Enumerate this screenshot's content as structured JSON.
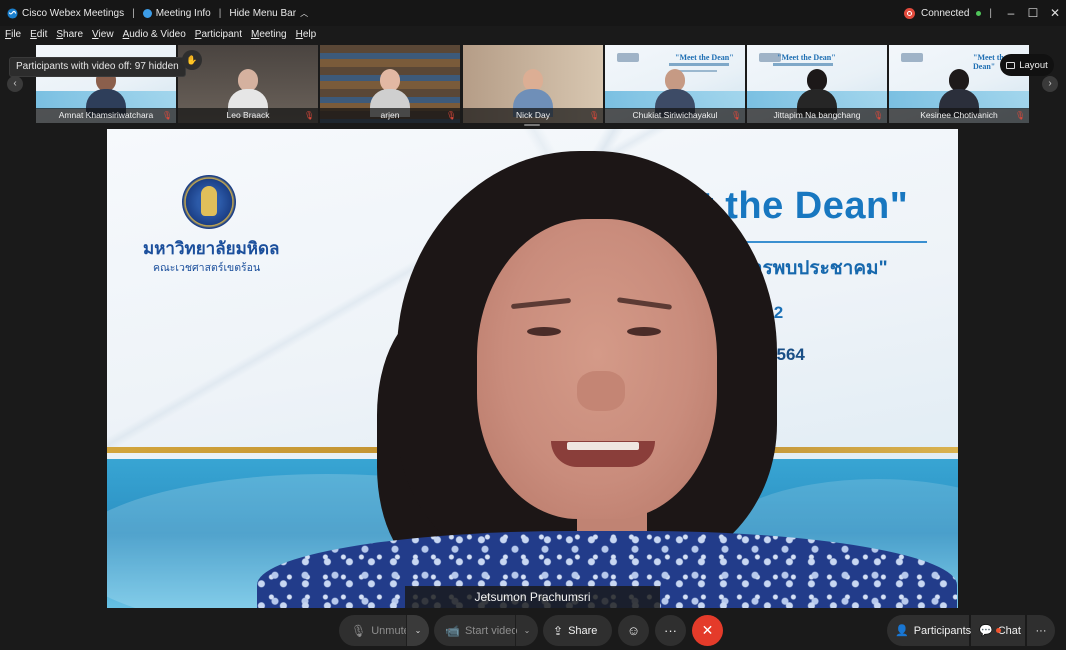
{
  "titlebar": {
    "app_name": "Cisco Webex Meetings",
    "separator": "|",
    "meeting_info": "Meeting Info",
    "hide_menu_bar": "Hide Menu Bar",
    "connection_status": "Connected",
    "colors": {
      "connected_dot": "#e24a3c",
      "green_dot": "#4fc55a"
    }
  },
  "window_controls": {
    "minimize": "–",
    "maximize": "☐",
    "close": "✕"
  },
  "menubar": {
    "items": [
      {
        "key": "F",
        "rest": "ile"
      },
      {
        "key": "E",
        "rest": "dit"
      },
      {
        "key": "S",
        "rest": "hare"
      },
      {
        "key": "V",
        "rest": "iew"
      },
      {
        "key": "A",
        "rest": "udio & Video"
      },
      {
        "key": "P",
        "rest": "articipant"
      },
      {
        "key": "M",
        "rest": "eeting"
      },
      {
        "key": "H",
        "rest": "elp"
      }
    ]
  },
  "video_strip": {
    "tooltip": "Participants with video off: 97 hidden",
    "participants": [
      {
        "name": "Amnat Khamsiriwatchara",
        "muted": true
      },
      {
        "name": "Leo Braack",
        "muted": true
      },
      {
        "name": "arjen",
        "muted": true
      },
      {
        "name": "Nick Day",
        "muted": true
      },
      {
        "name": "Chukiat Siriwichayakul",
        "muted": true
      },
      {
        "name": "Jittapim Na bangchang",
        "muted": true
      },
      {
        "name": "Kesinee Chotivanich",
        "muted": true
      }
    ],
    "layout_label": "Layout",
    "thumb_slide_title": "\"Meet the Dean\""
  },
  "main_video": {
    "speaker_name": "Jetsumon Prachumsri",
    "slide": {
      "university_name": "มหาวิทยาลัยมหิดล",
      "faculty_name": "คณะเวชศาสตร์เขตร้อน",
      "title": "t the Dean\"",
      "subtitle": "ทีมบริหารพบประชาคม\"",
      "session": "ครั้งที่ 2",
      "date": "หาคม 2564"
    }
  },
  "controls": {
    "unmute": "Unmute",
    "start_video": "Start video",
    "share": "Share",
    "more": "···",
    "end": "✕",
    "participants": "Participants",
    "chat": "Chat",
    "more_right": "···",
    "colors": {
      "end_button": "#e43b2a",
      "chat_badge": "#f0542f"
    }
  }
}
